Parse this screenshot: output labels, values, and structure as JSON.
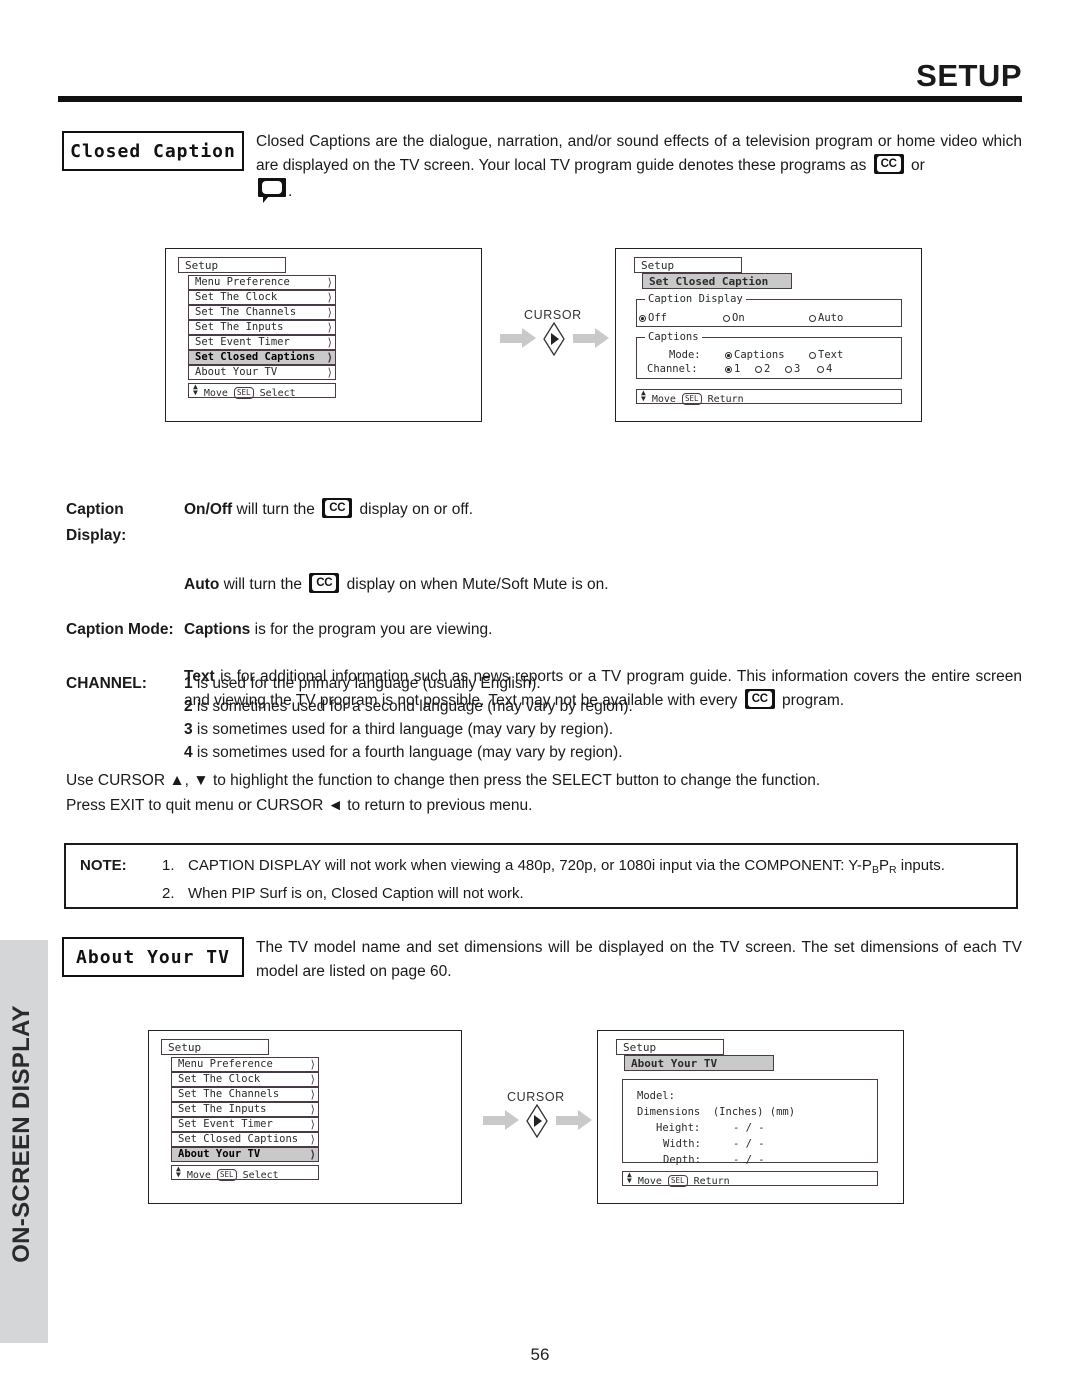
{
  "header": {
    "title": "SETUP"
  },
  "side_tab": {
    "label": "ON-SCREEN DISPLAY"
  },
  "page_number": "56",
  "closed_caption": {
    "label": "Closed Caption",
    "intro_part1": "Closed Captions are the dialogue, narration, and/or sound effects of a television program or home video which are displayed on the TV screen.  Your local TV program guide denotes these programs as",
    "intro_or": "or",
    "intro_end": ".",
    "cc_icon": "cc-icon",
    "balloon_icon": "caption-balloon-icon"
  },
  "definitions": [
    {
      "term": "Caption Display:",
      "lead": "On/Off",
      "body_before": " will turn the",
      "body_after": "display on or off."
    },
    {
      "term": "",
      "lead": "Auto",
      "body_before": " will turn the",
      "body_after": "display on when Mute/Soft Mute is on."
    },
    {
      "term": "Caption Mode:",
      "lead": "Captions",
      "body_before": " is for the program you are viewing.",
      "body_after": ""
    }
  ],
  "text_paragraph": {
    "lead": "Text",
    "part1": " is for additional information such as news reports or a TV program guide.  This information covers the entire screen and viewing the TV program is not possible.  Text may not be available with every",
    "part2": "program."
  },
  "channel": {
    "term": "CHANNEL:",
    "rows": [
      {
        "num": "1",
        "text": " is used for the primary language (usually English)."
      },
      {
        "num": "2",
        "text": " is sometimes used for a second language (may vary by region)."
      },
      {
        "num": "3",
        "text": " is sometimes used for a third language (may vary by region)."
      },
      {
        "num": "4",
        "text": " is sometimes used for a fourth language (may vary by region)."
      }
    ]
  },
  "cursor_note": {
    "line1": "Use CURSOR ▲, ▼ to highlight the function to change then press the SELECT button to change the function.",
    "line2": "Press EXIT to quit menu or CURSOR ◄ to return to previous menu."
  },
  "note": {
    "label": "NOTE:",
    "items": [
      {
        "num": "1.",
        "pre": "CAPTION DISPLAY will not work when viewing a 480p, 720p, or 1080i input via the COMPONENT: Y-P",
        "sub1": "B",
        "mid": "P",
        "sub2": "R",
        "post": " inputs."
      },
      {
        "num": "2.",
        "pre": "When PIP Surf is on, Closed Caption will not work.",
        "sub1": "",
        "mid": "",
        "sub2": "",
        "post": ""
      }
    ]
  },
  "about_your_tv": {
    "label": "About Your TV",
    "intro": "The TV model name and set dimensions will be displayed on the TV screen.  The set dimensions of each TV model are listed on page 60."
  },
  "flow": {
    "cursor_label": "CURSOR",
    "arrow_icon": "right-arrow-icon",
    "cursor_button_icon": "cursor-right-button-icon"
  },
  "osd": {
    "setup_menu_cc": {
      "title": "Setup",
      "rows": [
        "Menu Preference",
        "Set The Clock",
        "Set The Channels",
        "Set The Inputs",
        "Set Event Timer",
        "Set Closed Captions",
        "About Your TV"
      ],
      "highlighted": "Set Closed Captions",
      "hint_move": "Move",
      "hint_key": "SEL",
      "hint_action": "Select"
    },
    "setup_menu_about": {
      "title": "Setup",
      "rows": [
        "Menu Preference",
        "Set The Clock",
        "Set The Channels",
        "Set The Inputs",
        "Set Event Timer",
        "Set Closed Captions",
        "About Your TV"
      ],
      "highlighted": "About Your TV",
      "hint_move": "Move",
      "hint_key": "SEL",
      "hint_action": "Select"
    },
    "set_closed_caption": {
      "breadcrumb": "Setup",
      "title": "Set Closed Caption",
      "caption_display": {
        "legend": "Caption Display",
        "options": [
          {
            "label": "Off",
            "selected": true
          },
          {
            "label": "On",
            "selected": false
          },
          {
            "label": "Auto",
            "selected": false
          }
        ]
      },
      "captions": {
        "legend": "Captions",
        "mode_label": "Mode:",
        "mode_options": [
          {
            "label": "Captions",
            "selected": true
          },
          {
            "label": "Text",
            "selected": false
          }
        ],
        "channel_label": "Channel:",
        "channel_options": [
          {
            "label": "1",
            "selected": true
          },
          {
            "label": "2",
            "selected": false
          },
          {
            "label": "3",
            "selected": false
          },
          {
            "label": "4",
            "selected": false
          }
        ]
      },
      "hint_move": "Move",
      "hint_key": "SEL",
      "hint_action": "Return"
    },
    "about_screen": {
      "breadcrumb": "Setup",
      "title": "About Your TV",
      "model_label": "Model:",
      "dimensions_label": "Dimensions  (Inches) (mm)",
      "rows": [
        {
          "label": "Height:",
          "value": "- / -"
        },
        {
          "label": "Width:",
          "value": "- / -"
        },
        {
          "label": "Depth:",
          "value": "- / -"
        }
      ],
      "hint_move": "Move",
      "hint_key": "SEL",
      "hint_action": "Return"
    }
  },
  "colors": {
    "tab_gray": "#d4d6d8",
    "highlight_gray": "#c9c9c9",
    "arrow_gray": "#c9c9c9",
    "ink": "#1a1a1a"
  }
}
